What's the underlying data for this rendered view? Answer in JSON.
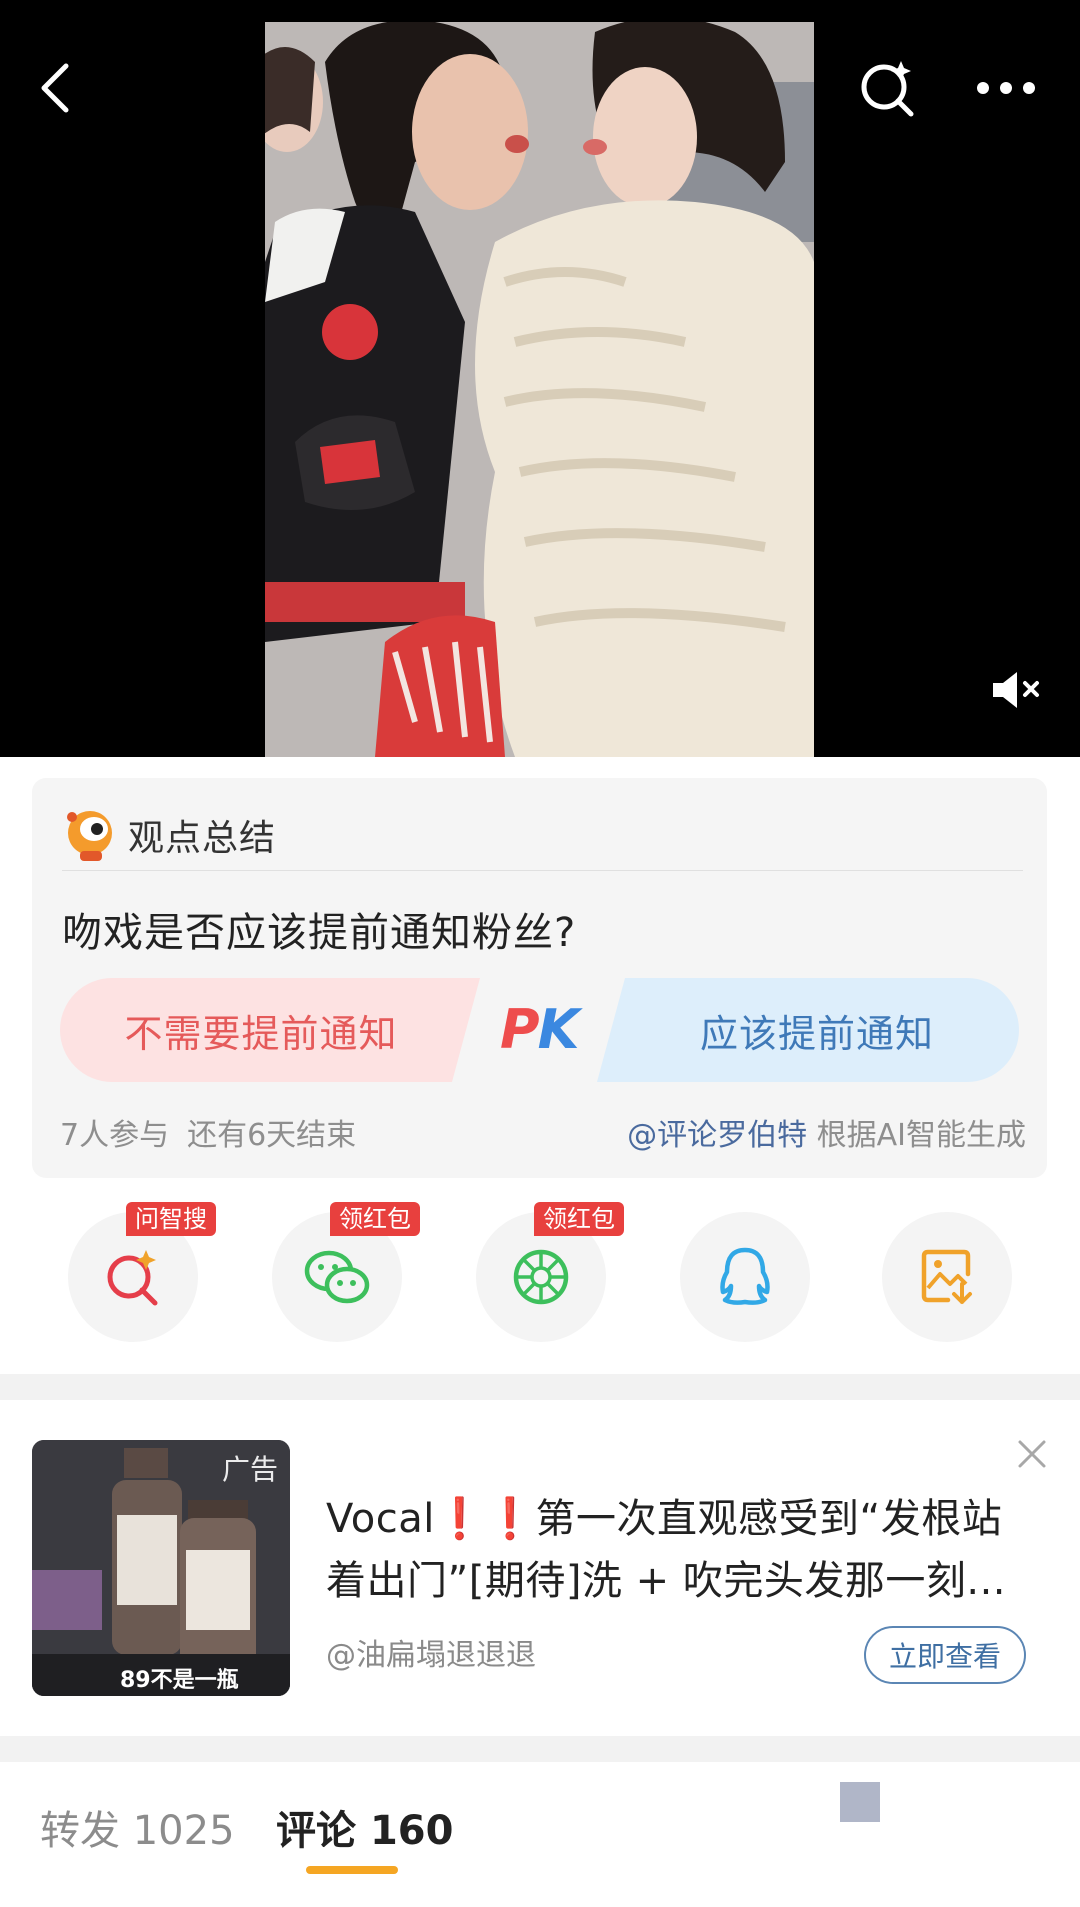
{
  "video": {
    "colors": {
      "background": "#000000"
    },
    "icons": {
      "back": "chevron-left-icon",
      "search": "ai-search-icon",
      "more": "more-dots-icon",
      "mute": "speaker-muted-icon"
    }
  },
  "summary_card": {
    "title": "观点总结",
    "question": "吻戏是否应该提前通知粉丝?",
    "option_left": "不需要提前通知",
    "option_right": "应该提前通知",
    "pk_p": "P",
    "pk_k": "K",
    "participants": "7人参与",
    "remaining": "还有6天结束",
    "source_account": "@评论罗伯特",
    "source_suffix": "根据AI智能生成",
    "colors": {
      "left_option": "#fde2e2",
      "right_option": "#ddeefb",
      "pk_p": "#ee4d4d",
      "pk_k": "#3b88e0"
    }
  },
  "share_actions": [
    {
      "icon": "ai-search-icon",
      "badge": "问智搜"
    },
    {
      "icon": "wechat-icon",
      "badge": "领红包"
    },
    {
      "icon": "moments-icon",
      "badge": "领红包"
    },
    {
      "icon": "qq-icon",
      "badge": ""
    },
    {
      "icon": "save-image-icon",
      "badge": ""
    }
  ],
  "ad": {
    "tag": "广告",
    "thumb_caption": "89不是一瓶",
    "title_prefix": "Vocal",
    "title_marks": "❗❗",
    "title_rest": "第一次直观感受到“发根站着出门”[期待]洗 + 吹完头发那一刻...",
    "author": "@油扁塌退退退",
    "cta": "立即查看"
  },
  "tabs": {
    "forward_label": "转发",
    "forward_count": "1025",
    "comment_label": "评论",
    "comment_count": "160",
    "colors": {
      "active_underline": "#f5a623"
    }
  }
}
